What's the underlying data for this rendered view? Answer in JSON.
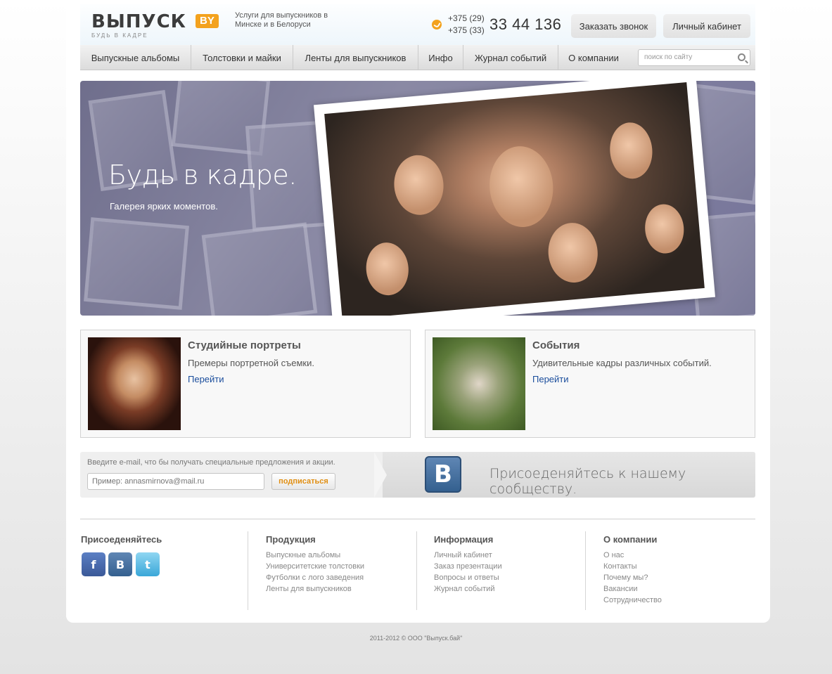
{
  "header": {
    "logo_text": "ВЫПУСК",
    "logo_badge": "BY",
    "logo_tagline": "БУДЬ В КАДРЕ",
    "tagline": "Услуги для выпускников в Минске и в Белоруси",
    "phone_code_1": "+375 (29)",
    "phone_code_2": "+375 (33)",
    "phone_number": "33 44 136",
    "call_button": "Заказать звонок",
    "cabinet_button": "Личный кабинет"
  },
  "nav": {
    "items": [
      "Выпускные альбомы",
      "Толстовки и майки",
      "Ленты для выпускников",
      "Инфо",
      "Журнал событий",
      "О компании"
    ],
    "search_placeholder": "поиск по сайту"
  },
  "hero": {
    "title": "Будь в кадре.",
    "subtitle": "Галерея ярких моментов."
  },
  "cards": [
    {
      "title": "Студийные портреты",
      "description": "Премеры портретной съемки.",
      "link": "Перейти"
    },
    {
      "title": "События",
      "description": "Удивительные кадры различных событий.",
      "link": "Перейти"
    }
  ],
  "subscribe": {
    "label": "Введите e-mail, что бы получать специальные предложения и акции.",
    "placeholder": "Пример: annasmirnova@mail.ru",
    "button": "подписаться",
    "vk_letter": "B",
    "community": "Присоеденяйтесь к нашему сообществу."
  },
  "footer": {
    "join_title": "Присоеденяйтесь",
    "social": [
      "f",
      "B",
      "t"
    ],
    "products": {
      "title": "Продукция",
      "links": [
        "Выпускные альбомы",
        "Университетские толстовки",
        "Футболки с лого заведения",
        "Ленты для выпускников"
      ]
    },
    "info": {
      "title": "Информация",
      "links": [
        "Личный кабинет",
        "Заказ презентации",
        "Вопросы и ответы",
        "Журнал событий"
      ]
    },
    "company": {
      "title": "О компании",
      "links": [
        "О нас",
        "Контакты",
        "Почему мы?",
        "Вакансии",
        "Сотрудничество"
      ]
    },
    "copyright": "2011-2012  ©  ООО \"Выпуск.бай\""
  },
  "colors": {
    "accent": "#f3a21e",
    "link": "#1a4d9c",
    "hero": "#7d7c98"
  }
}
